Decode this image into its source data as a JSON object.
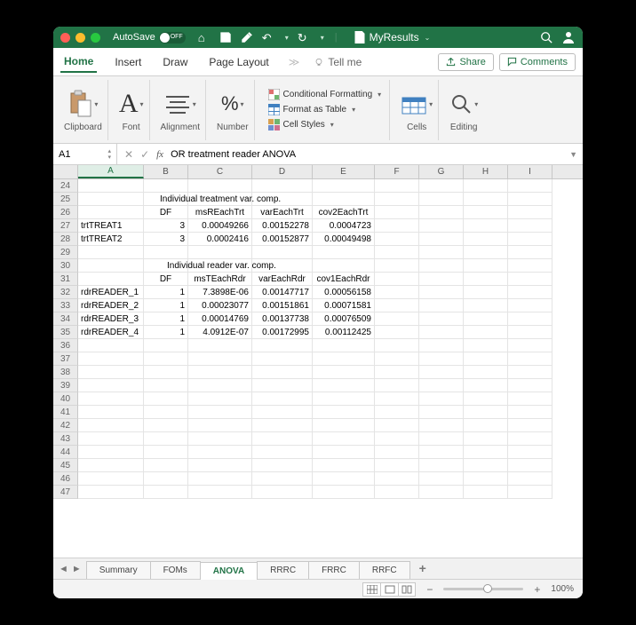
{
  "titlebar": {
    "autosave_label": "AutoSave",
    "autosave_state": "OFF",
    "filename": "MyResults"
  },
  "ribbon": {
    "tabs": [
      "Home",
      "Insert",
      "Draw",
      "Page Layout"
    ],
    "tellme": "Tell me",
    "share": "Share",
    "comments": "Comments",
    "groups": {
      "clipboard": "Clipboard",
      "font": "Font",
      "alignment": "Alignment",
      "number": "Number",
      "cond_fmt": "Conditional Formatting",
      "fmt_table": "Format as Table",
      "cell_styles": "Cell Styles",
      "cells": "Cells",
      "editing": "Editing"
    }
  },
  "fbar": {
    "namebox": "A1",
    "formula": "OR treatment reader ANOVA"
  },
  "columns": [
    "A",
    "B",
    "C",
    "D",
    "E",
    "F",
    "G",
    "H",
    "I"
  ],
  "first_row": 24,
  "sections": {
    "trt_title": "Individual treatment var. comp.",
    "rdr_title": "Individual reader var. comp."
  },
  "headers_trt": {
    "B": "DF",
    "C": "msREachTrt",
    "D": "varEachTrt",
    "E": "cov2EachTrt"
  },
  "headers_rdr": {
    "B": "DF",
    "C": "msTEachRdr",
    "D": "varEachRdr",
    "E": "cov1EachRdr"
  },
  "trt_rows": [
    {
      "A": "trtTREAT1",
      "B": "3",
      "C": "0.00049266",
      "D": "0.00152278",
      "E": "0.0004723"
    },
    {
      "A": "trtTREAT2",
      "B": "3",
      "C": "0.0002416",
      "D": "0.00152877",
      "E": "0.00049498"
    }
  ],
  "rdr_rows": [
    {
      "A": "rdrREADER_1",
      "B": "1",
      "C": "7.3898E-06",
      "D": "0.00147717",
      "E": "0.00056158"
    },
    {
      "A": "rdrREADER_2",
      "B": "1",
      "C": "0.00023077",
      "D": "0.00151861",
      "E": "0.00071581"
    },
    {
      "A": "rdrREADER_3",
      "B": "1",
      "C": "0.00014769",
      "D": "0.00137738",
      "E": "0.00076509"
    },
    {
      "A": "rdrREADER_4",
      "B": "1",
      "C": "4.0912E-07",
      "D": "0.00172995",
      "E": "0.00112425"
    }
  ],
  "sheet_tabs": [
    "Summary",
    "FOMs",
    "ANOVA",
    "RRRC",
    "FRRC",
    "RRFC"
  ],
  "active_sheet_tab": "ANOVA",
  "status": {
    "zoom": "100%"
  }
}
